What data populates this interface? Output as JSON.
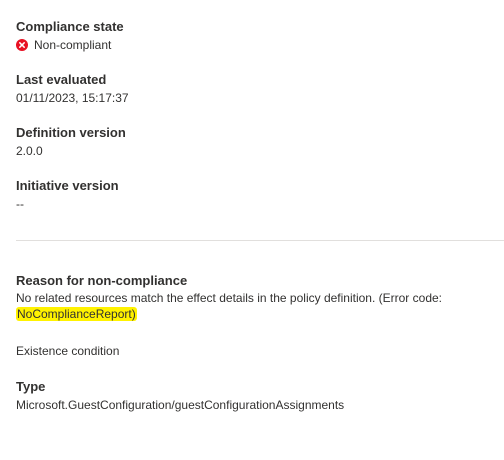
{
  "compliance_state": {
    "label": "Compliance state",
    "value": "Non-compliant",
    "status_color": "#e81123",
    "icon": "error-circle-icon"
  },
  "last_evaluated": {
    "label": "Last evaluated",
    "value": "01/11/2023, 15:17:37"
  },
  "definition_version": {
    "label": "Definition version",
    "value": "2.0.0"
  },
  "initiative_version": {
    "label": "Initiative version",
    "value": "--"
  },
  "reason": {
    "label": "Reason for non-compliance",
    "text_before": "No related resources match the effect details in the policy definition. (Error code: ",
    "error_code": "NoComplianceReport)",
    "highlight_color": "#fff200"
  },
  "existence_condition": {
    "text": "Existence condition"
  },
  "type": {
    "label": "Type",
    "value": "Microsoft.GuestConfiguration/guestConfigurationAssignments"
  }
}
